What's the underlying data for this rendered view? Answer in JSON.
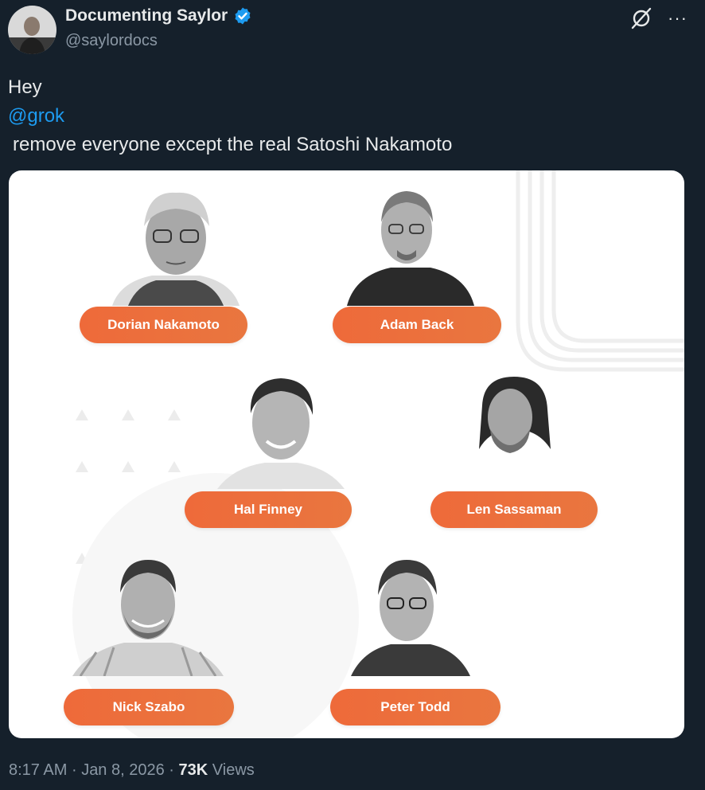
{
  "author": {
    "display_name": "Documenting Saylor",
    "handle": "@saylordocs",
    "verified_icon": "verified-badge-icon",
    "accent": "#1d9bf0"
  },
  "actions": {
    "grok_icon": "grok-icon",
    "more_label": "···"
  },
  "tweet": {
    "line1": "Hey",
    "mention": "@grok",
    "line3": "remove everyone except the real Satoshi Nakamoto"
  },
  "image": {
    "people": [
      {
        "label": "Dorian Nakamoto"
      },
      {
        "label": "Adam Back"
      },
      {
        "label": "Hal Finney"
      },
      {
        "label": "Len Sassaman"
      },
      {
        "label": "Nick Szabo"
      },
      {
        "label": "Peter Todd"
      }
    ],
    "pill_color": "#ee6a3a"
  },
  "meta": {
    "time": "8:17 AM",
    "date": "Jan 8, 2026",
    "separator": "·",
    "views_count": "73K",
    "views_label": "Views"
  }
}
